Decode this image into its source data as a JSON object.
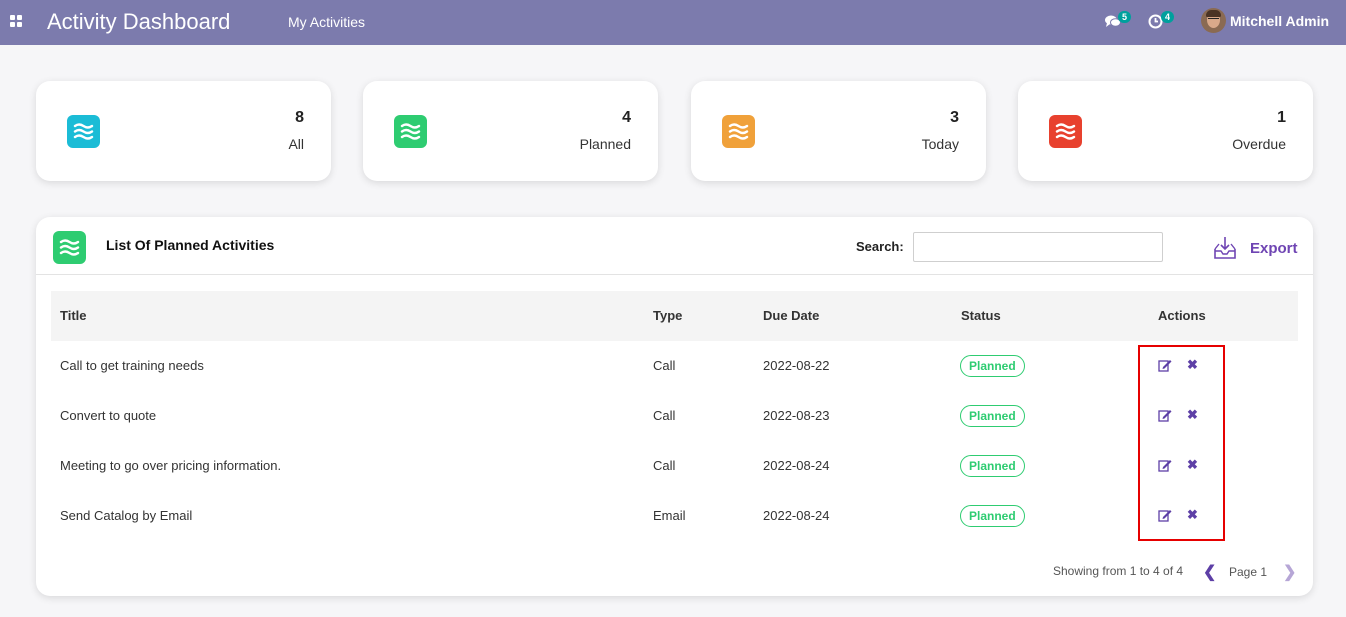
{
  "navbar": {
    "brand": "Activity Dashboard",
    "menu": "My Activities",
    "messages_count": "5",
    "activities_count": "4",
    "user_name": "Mitchell Admin"
  },
  "cards": [
    {
      "count": "8",
      "label": "All",
      "color": "#1bbcd6"
    },
    {
      "count": "4",
      "label": "Planned",
      "color": "#2ecc71"
    },
    {
      "count": "3",
      "label": "Today",
      "color": "#f0a13a"
    },
    {
      "count": "1",
      "label": "Overdue",
      "color": "#e8412e"
    }
  ],
  "panel": {
    "title": "List Of Planned Activities",
    "search_label": "Search:",
    "search_value": "",
    "export_label": "Export"
  },
  "table": {
    "headers": [
      "Title",
      "Type",
      "Due Date",
      "Status",
      "Actions"
    ],
    "rows": [
      {
        "title": "Call to get training needs",
        "type": "Call",
        "due": "2022-08-22",
        "status": "Planned"
      },
      {
        "title": "Convert to quote",
        "type": "Call",
        "due": "2022-08-23",
        "status": "Planned"
      },
      {
        "title": "Meeting to go over pricing information.",
        "type": "Call",
        "due": "2022-08-24",
        "status": "Planned"
      },
      {
        "title": "Send Catalog by Email",
        "type": "Email",
        "due": "2022-08-24",
        "status": "Planned"
      }
    ]
  },
  "pager": {
    "info": "Showing from 1 to 4 of 4",
    "page": "Page 1"
  },
  "icons": {
    "apps": "apps-grid-icon",
    "messages": "chat-bubbles-icon",
    "activities": "clock-icon",
    "card": "waves-icon",
    "export": "download-tray-icon",
    "edit": "edit-icon",
    "delete": "close-icon",
    "prev": "chevron-left-icon",
    "next": "chevron-right-icon"
  },
  "colors": {
    "navbar": "#7c7bad",
    "accent": "#6f45b3",
    "status_green": "#2ecc71",
    "highlight": "#e60000"
  }
}
